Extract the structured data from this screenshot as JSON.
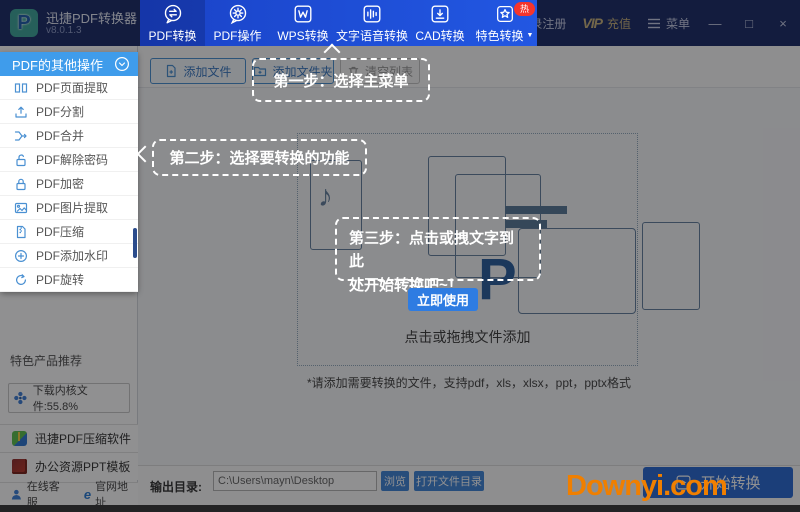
{
  "app": {
    "title": "迅捷PDF转换器",
    "version": "v8.0.1.3"
  },
  "topbar": {
    "tabs": [
      {
        "label": "PDF转换",
        "active": true
      },
      {
        "label": "PDF操作"
      },
      {
        "label": "WPS转换"
      },
      {
        "label": "文字语音转换"
      },
      {
        "label": "CAD转换"
      },
      {
        "label": "特色转换",
        "badge": "热"
      }
    ],
    "login": "登录注册",
    "vip": "VIP",
    "vip_suffix": "充值",
    "menu": "菜单",
    "window_controls": {
      "minimize": "—",
      "maximize": "□",
      "close": "×"
    }
  },
  "sidebar": {
    "panel_header": "PDF的其他操作",
    "items": [
      {
        "label": "PDF页面提取"
      },
      {
        "label": "PDF分割"
      },
      {
        "label": "PDF合并"
      },
      {
        "label": "PDF解除密码"
      },
      {
        "label": "PDF加密"
      },
      {
        "label": "PDF图片提取"
      },
      {
        "label": "PDF压缩"
      },
      {
        "label": "PDF添加水印"
      },
      {
        "label": "PDF旋转"
      }
    ],
    "promo_title": "特色产品推荐",
    "download_button": "下载内核文件:55.8%",
    "products": [
      {
        "label": "迅捷PDF压缩软件"
      },
      {
        "label": "办公资源PPT模板"
      }
    ],
    "footer": [
      {
        "label": "在线客服"
      },
      {
        "label": "官网地址"
      }
    ]
  },
  "toolbar": {
    "add_file": "添加文件",
    "add_folder": "添加文件夹",
    "clear_list": "清空列表"
  },
  "main": {
    "dropzone_text": "点击或拖拽文件添加",
    "note": "*请添加需要转换的文件，支持pdf，xls，xlsx，ppt，pptx格式",
    "illustration_letter": "P"
  },
  "tutorial": {
    "step1": "第一步：选择主菜单",
    "step2": "第二步：选择要转换的功能",
    "step3_line1": "第三步：点击或拽文字到此",
    "step3_line2": "处开始转换吧~！",
    "cta": "立即使用"
  },
  "output_bar": {
    "label": "输出目录:",
    "path": "C:\\Users\\mayn\\Desktop",
    "browse": "浏览",
    "open_dir": "打开文件目录",
    "start": "开始转换"
  },
  "watermark": "Downyi.com",
  "colors": {
    "topbar": "#1c2d68",
    "tabs_blue": "#2257e2",
    "sidebar_header": "#3f9ceb",
    "accent_blue": "#2e7ce2",
    "badge_red": "#f5352c",
    "watermark_orange": "#f07f00"
  }
}
